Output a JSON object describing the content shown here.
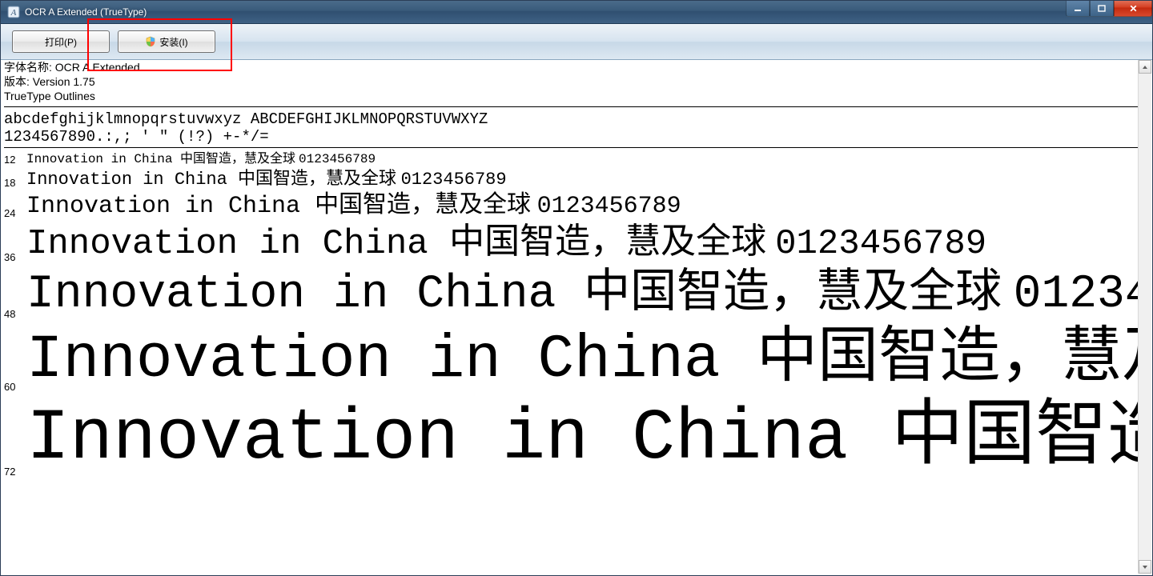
{
  "window": {
    "title": "OCR A Extended (TrueType)"
  },
  "toolbar": {
    "print_label": "打印(P)",
    "install_label": "安装(I)"
  },
  "meta": {
    "font_name_label": "字体名称: ",
    "font_name_value": "OCR A Extended",
    "version_label": "版本: ",
    "version_value": "Version 1.75",
    "outlines": "TrueType Outlines"
  },
  "charset": {
    "line1": "abcdefghijklmnopqrstuvwxyz ABCDEFGHIJKLMNOPQRSTUVWXYZ",
    "line2": "1234567890.:,; ' \" (!?) +-*/="
  },
  "sample": {
    "latin": "Innovation in China ",
    "cjk": "中国智造，慧及全球 ",
    "digits": "0123456789"
  },
  "sizes": [
    "12",
    "18",
    "24",
    "36",
    "48",
    "60",
    "72"
  ]
}
